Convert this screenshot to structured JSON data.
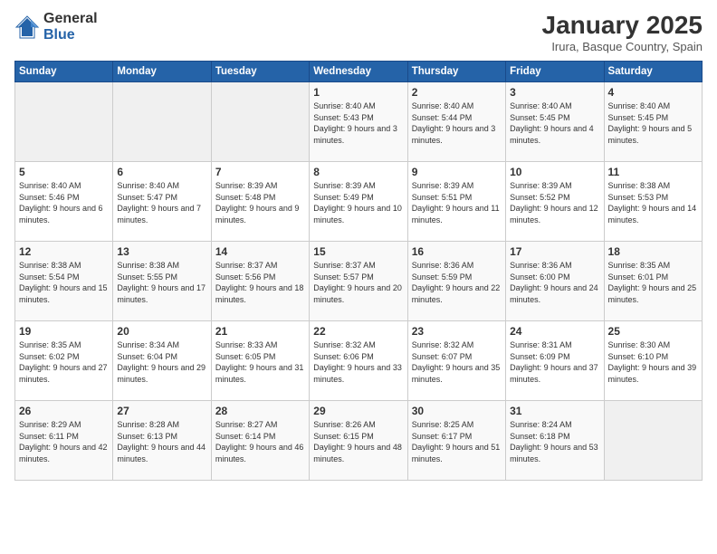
{
  "logo": {
    "general": "General",
    "blue": "Blue"
  },
  "title": "January 2025",
  "subtitle": "Irura, Basque Country, Spain",
  "days_of_week": [
    "Sunday",
    "Monday",
    "Tuesday",
    "Wednesday",
    "Thursday",
    "Friday",
    "Saturday"
  ],
  "weeks": [
    [
      {
        "num": "",
        "info": ""
      },
      {
        "num": "",
        "info": ""
      },
      {
        "num": "",
        "info": ""
      },
      {
        "num": "1",
        "info": "Sunrise: 8:40 AM\nSunset: 5:43 PM\nDaylight: 9 hours and 3 minutes."
      },
      {
        "num": "2",
        "info": "Sunrise: 8:40 AM\nSunset: 5:44 PM\nDaylight: 9 hours and 3 minutes."
      },
      {
        "num": "3",
        "info": "Sunrise: 8:40 AM\nSunset: 5:45 PM\nDaylight: 9 hours and 4 minutes."
      },
      {
        "num": "4",
        "info": "Sunrise: 8:40 AM\nSunset: 5:45 PM\nDaylight: 9 hours and 5 minutes."
      }
    ],
    [
      {
        "num": "5",
        "info": "Sunrise: 8:40 AM\nSunset: 5:46 PM\nDaylight: 9 hours and 6 minutes."
      },
      {
        "num": "6",
        "info": "Sunrise: 8:40 AM\nSunset: 5:47 PM\nDaylight: 9 hours and 7 minutes."
      },
      {
        "num": "7",
        "info": "Sunrise: 8:39 AM\nSunset: 5:48 PM\nDaylight: 9 hours and 9 minutes."
      },
      {
        "num": "8",
        "info": "Sunrise: 8:39 AM\nSunset: 5:49 PM\nDaylight: 9 hours and 10 minutes."
      },
      {
        "num": "9",
        "info": "Sunrise: 8:39 AM\nSunset: 5:51 PM\nDaylight: 9 hours and 11 minutes."
      },
      {
        "num": "10",
        "info": "Sunrise: 8:39 AM\nSunset: 5:52 PM\nDaylight: 9 hours and 12 minutes."
      },
      {
        "num": "11",
        "info": "Sunrise: 8:38 AM\nSunset: 5:53 PM\nDaylight: 9 hours and 14 minutes."
      }
    ],
    [
      {
        "num": "12",
        "info": "Sunrise: 8:38 AM\nSunset: 5:54 PM\nDaylight: 9 hours and 15 minutes."
      },
      {
        "num": "13",
        "info": "Sunrise: 8:38 AM\nSunset: 5:55 PM\nDaylight: 9 hours and 17 minutes."
      },
      {
        "num": "14",
        "info": "Sunrise: 8:37 AM\nSunset: 5:56 PM\nDaylight: 9 hours and 18 minutes."
      },
      {
        "num": "15",
        "info": "Sunrise: 8:37 AM\nSunset: 5:57 PM\nDaylight: 9 hours and 20 minutes."
      },
      {
        "num": "16",
        "info": "Sunrise: 8:36 AM\nSunset: 5:59 PM\nDaylight: 9 hours and 22 minutes."
      },
      {
        "num": "17",
        "info": "Sunrise: 8:36 AM\nSunset: 6:00 PM\nDaylight: 9 hours and 24 minutes."
      },
      {
        "num": "18",
        "info": "Sunrise: 8:35 AM\nSunset: 6:01 PM\nDaylight: 9 hours and 25 minutes."
      }
    ],
    [
      {
        "num": "19",
        "info": "Sunrise: 8:35 AM\nSunset: 6:02 PM\nDaylight: 9 hours and 27 minutes."
      },
      {
        "num": "20",
        "info": "Sunrise: 8:34 AM\nSunset: 6:04 PM\nDaylight: 9 hours and 29 minutes."
      },
      {
        "num": "21",
        "info": "Sunrise: 8:33 AM\nSunset: 6:05 PM\nDaylight: 9 hours and 31 minutes."
      },
      {
        "num": "22",
        "info": "Sunrise: 8:32 AM\nSunset: 6:06 PM\nDaylight: 9 hours and 33 minutes."
      },
      {
        "num": "23",
        "info": "Sunrise: 8:32 AM\nSunset: 6:07 PM\nDaylight: 9 hours and 35 minutes."
      },
      {
        "num": "24",
        "info": "Sunrise: 8:31 AM\nSunset: 6:09 PM\nDaylight: 9 hours and 37 minutes."
      },
      {
        "num": "25",
        "info": "Sunrise: 8:30 AM\nSunset: 6:10 PM\nDaylight: 9 hours and 39 minutes."
      }
    ],
    [
      {
        "num": "26",
        "info": "Sunrise: 8:29 AM\nSunset: 6:11 PM\nDaylight: 9 hours and 42 minutes."
      },
      {
        "num": "27",
        "info": "Sunrise: 8:28 AM\nSunset: 6:13 PM\nDaylight: 9 hours and 44 minutes."
      },
      {
        "num": "28",
        "info": "Sunrise: 8:27 AM\nSunset: 6:14 PM\nDaylight: 9 hours and 46 minutes."
      },
      {
        "num": "29",
        "info": "Sunrise: 8:26 AM\nSunset: 6:15 PM\nDaylight: 9 hours and 48 minutes."
      },
      {
        "num": "30",
        "info": "Sunrise: 8:25 AM\nSunset: 6:17 PM\nDaylight: 9 hours and 51 minutes."
      },
      {
        "num": "31",
        "info": "Sunrise: 8:24 AM\nSunset: 6:18 PM\nDaylight: 9 hours and 53 minutes."
      },
      {
        "num": "",
        "info": ""
      }
    ]
  ]
}
